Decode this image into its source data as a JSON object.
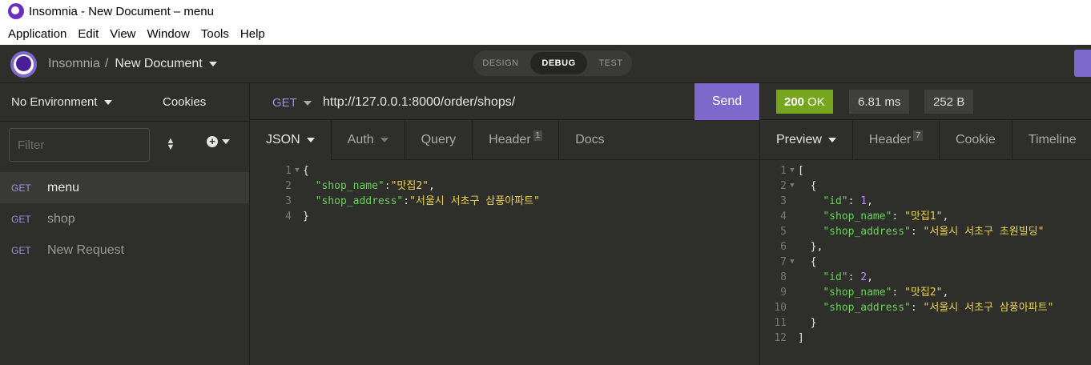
{
  "window": {
    "title": "Insomnia - New Document – menu"
  },
  "menubar": [
    "Application",
    "Edit",
    "View",
    "Window",
    "Tools",
    "Help"
  ],
  "topbar": {
    "workspace": "Insomnia",
    "separator": "/",
    "document": "New Document",
    "modes": {
      "design": "DESIGN",
      "debug": "DEBUG",
      "test": "TEST"
    }
  },
  "sidebar": {
    "environment": "No Environment",
    "cookies": "Cookies",
    "filter_placeholder": "Filter",
    "requests": [
      {
        "method": "GET",
        "name": "menu"
      },
      {
        "method": "GET",
        "name": "shop"
      },
      {
        "method": "GET",
        "name": "New Request"
      }
    ]
  },
  "request": {
    "method": "GET",
    "url": "http://127.0.0.1:8000/order/shops/",
    "send": "Send",
    "tabs": {
      "body": "JSON",
      "auth": "Auth",
      "query": "Query",
      "header": "Header",
      "header_count": "1",
      "docs": "Docs"
    },
    "body_lines": [
      {
        "n": "1",
        "fold": true,
        "parts": [
          [
            "punct",
            "{"
          ]
        ]
      },
      {
        "n": "2",
        "fold": false,
        "parts": [
          [
            "punct",
            "  "
          ],
          [
            "key",
            "\"shop_name\""
          ],
          [
            "punct",
            ":"
          ],
          [
            "str",
            "\"맛집2\""
          ],
          [
            "punct",
            ","
          ]
        ]
      },
      {
        "n": "3",
        "fold": false,
        "parts": [
          [
            "punct",
            "  "
          ],
          [
            "key",
            "\"shop_address\""
          ],
          [
            "punct",
            ":"
          ],
          [
            "str",
            "\"서울시 서초구 삼풍아파트\""
          ]
        ]
      },
      {
        "n": "4",
        "fold": false,
        "parts": [
          [
            "punct",
            "}"
          ]
        ]
      }
    ]
  },
  "response": {
    "status_code": "200",
    "status_text": "OK",
    "time": "6.81 ms",
    "size": "252 B",
    "tabs": {
      "preview": "Preview",
      "header": "Header",
      "header_count": "7",
      "cookie": "Cookie",
      "timeline": "Timeline"
    },
    "body_lines": [
      {
        "n": "1",
        "fold": true,
        "parts": [
          [
            "punct",
            "["
          ]
        ]
      },
      {
        "n": "2",
        "fold": true,
        "parts": [
          [
            "punct",
            "  {"
          ]
        ]
      },
      {
        "n": "3",
        "fold": false,
        "parts": [
          [
            "punct",
            "    "
          ],
          [
            "key",
            "\"id\""
          ],
          [
            "punct",
            ": "
          ],
          [
            "num",
            "1"
          ],
          [
            "punct",
            ","
          ]
        ]
      },
      {
        "n": "4",
        "fold": false,
        "parts": [
          [
            "punct",
            "    "
          ],
          [
            "key",
            "\"shop_name\""
          ],
          [
            "punct",
            ": "
          ],
          [
            "str",
            "\"맛집1\""
          ],
          [
            "punct",
            ","
          ]
        ]
      },
      {
        "n": "5",
        "fold": false,
        "parts": [
          [
            "punct",
            "    "
          ],
          [
            "key",
            "\"shop_address\""
          ],
          [
            "punct",
            ": "
          ],
          [
            "str",
            "\"서울시 서초구 초원빌딩\""
          ]
        ]
      },
      {
        "n": "6",
        "fold": false,
        "parts": [
          [
            "punct",
            "  },"
          ]
        ]
      },
      {
        "n": "7",
        "fold": true,
        "parts": [
          [
            "punct",
            "  {"
          ]
        ]
      },
      {
        "n": "8",
        "fold": false,
        "parts": [
          [
            "punct",
            "    "
          ],
          [
            "key",
            "\"id\""
          ],
          [
            "punct",
            ": "
          ],
          [
            "num",
            "2"
          ],
          [
            "punct",
            ","
          ]
        ]
      },
      {
        "n": "9",
        "fold": false,
        "parts": [
          [
            "punct",
            "    "
          ],
          [
            "key",
            "\"shop_name\""
          ],
          [
            "punct",
            ": "
          ],
          [
            "str",
            "\"맛집2\""
          ],
          [
            "punct",
            ","
          ]
        ]
      },
      {
        "n": "10",
        "fold": false,
        "parts": [
          [
            "punct",
            "    "
          ],
          [
            "key",
            "\"shop_address\""
          ],
          [
            "punct",
            ": "
          ],
          [
            "str",
            "\"서울시 서초구 삼풍아파트\""
          ]
        ]
      },
      {
        "n": "11",
        "fold": false,
        "parts": [
          [
            "punct",
            "  }"
          ]
        ]
      },
      {
        "n": "12",
        "fold": false,
        "parts": [
          [
            "punct",
            "]"
          ]
        ]
      }
    ]
  },
  "colors": {
    "accent": "#7d69cb",
    "success": "#76a61e",
    "key": "#6ccf5a",
    "string": "#ebd24f",
    "number": "#b58cff"
  }
}
